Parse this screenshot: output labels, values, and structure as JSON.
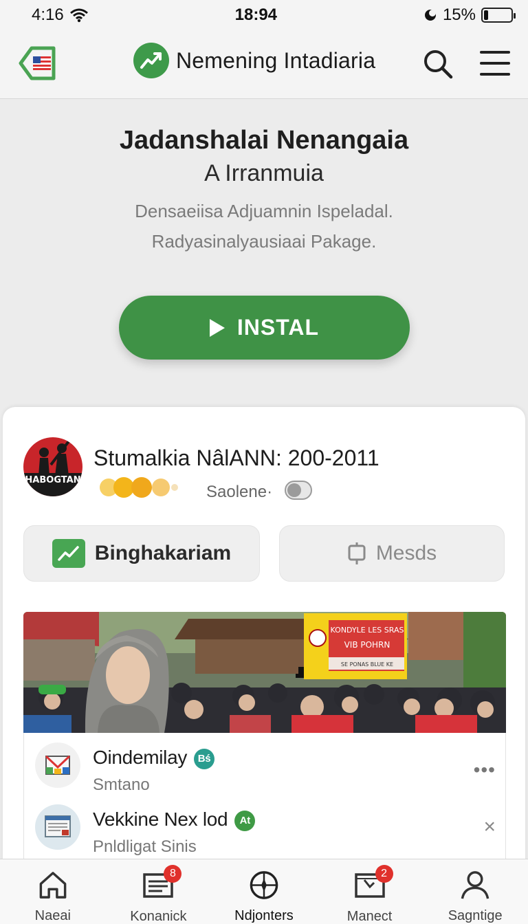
{
  "status_bar": {
    "time": "4:16",
    "center_time": "18:94",
    "battery_percent": "15%",
    "battery_level": 0.15,
    "icons": [
      "wifi-icon",
      "moon-icon",
      "battery-icon"
    ]
  },
  "header": {
    "title": "Nemening Intadiaria",
    "icons": [
      "flag-badge-icon",
      "brand-logo-icon",
      "search-icon",
      "menu-icon"
    ]
  },
  "hero": {
    "title": "Jadanshalai Nenangaia",
    "subtitle": "A Irranmuia",
    "description_line1": "Densaeiisa Adjuamnin Ispeladal.",
    "description_line2": "Radyasinalyausiaai Pakage.",
    "install_label": "INSTAL"
  },
  "profile": {
    "avatar_text": "HABOGTAN",
    "title": "Stumalkia  NâlANN: 200-2011",
    "toggle_label": "Saolene·",
    "toggle_on": false,
    "rating_dots": 4
  },
  "actions": {
    "primary_label": "Binghakariam",
    "secondary_label": "Mesds"
  },
  "photo": {
    "banner_line1": "KONDYLE LES SRAS",
    "banner_line2": "VIB POHRN",
    "banner_line3": "SE PONAS BLUE KE"
  },
  "list": [
    {
      "title": "Oindemilay",
      "subtitle": "Smtano",
      "badge": "Bś",
      "badge_color": "#2a9d8f",
      "action": "•••"
    },
    {
      "title": "Vekkine Nex lod",
      "subtitle": "Pnldligat Sinis",
      "badge": "At",
      "badge_color": "#3f9a45",
      "action": "×"
    }
  ],
  "bottom_nav": [
    {
      "label": "Naeai",
      "icon": "home-icon",
      "badge": ""
    },
    {
      "label": "Konanick",
      "icon": "news-icon",
      "badge": "8"
    },
    {
      "label": "Ndjonters",
      "icon": "compass-icon",
      "badge": ""
    },
    {
      "label": "Manect",
      "icon": "board-icon",
      "badge": "2"
    },
    {
      "label": "Sagntige",
      "icon": "profile-icon",
      "badge": ""
    }
  ],
  "colors": {
    "accent_green": "#3f9246",
    "notification_red": "#e0312c",
    "background": "#ececec"
  }
}
